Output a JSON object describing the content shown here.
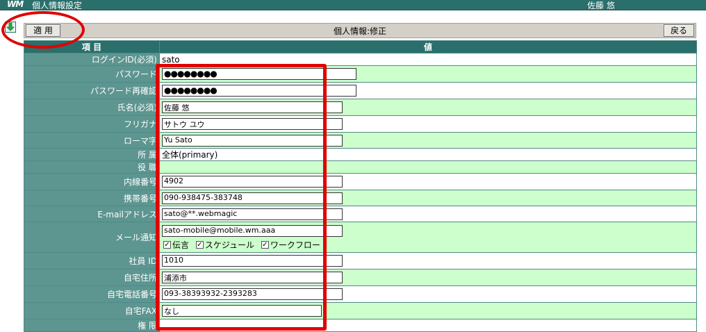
{
  "app": {
    "logo": "WM",
    "title": "個人情報設定",
    "user": "佐藤 悠"
  },
  "toolbar": {
    "apply_label": "適 用",
    "title": "個人情報:修正",
    "back_label": "戻る"
  },
  "icons": {
    "download": "download-arrow-icon"
  },
  "colors": {
    "header": "#2a6f6b",
    "label": "#5d9590",
    "alt_row": "#ccffcc",
    "annotation": "#e00000"
  },
  "table": {
    "header_item": "項 目",
    "header_value": "値",
    "login": {
      "label": "ログインID(必須)",
      "value": "sato"
    },
    "password": {
      "label": "パスワード",
      "value": "●●●●●●●●"
    },
    "password_confirm": {
      "label": "パスワード再確認",
      "value": "●●●●●●●●"
    },
    "name": {
      "label": "氏名(必須)",
      "value": "佐藤 悠"
    },
    "furigana": {
      "label": "フリガナ",
      "value": "サトウ ユウ"
    },
    "romaji": {
      "label": "ローマ字",
      "value": "Yu Sato"
    },
    "dept": {
      "label": "所 属",
      "value": "全体(primary)"
    },
    "position": {
      "label": "役 職",
      "value": ""
    },
    "extension": {
      "label": "内線番号",
      "value": "4902"
    },
    "mobile": {
      "label": "携帯番号",
      "value": "090-938475-383748"
    },
    "email": {
      "label": "E-mailアドレス",
      "value": "sato@**.webmagic"
    },
    "mail_notify": {
      "label": "メール通知",
      "value": "sato-mobile@mobile.wm.aaa",
      "options": [
        {
          "label": "伝言",
          "checked": true
        },
        {
          "label": "スケジュール",
          "checked": true
        },
        {
          "label": "ワークフロー",
          "checked": true
        }
      ]
    },
    "employee_id": {
      "label": "社員 ID",
      "value": "1010"
    },
    "home_address": {
      "label": "自宅住所",
      "value": "浦添市"
    },
    "home_phone": {
      "label": "自宅電話番号",
      "value": "093-38393932-2393283"
    },
    "home_fax": {
      "label": "自宅FAX",
      "value": "なし"
    },
    "authority": {
      "label": "権 限",
      "value": ""
    }
  }
}
